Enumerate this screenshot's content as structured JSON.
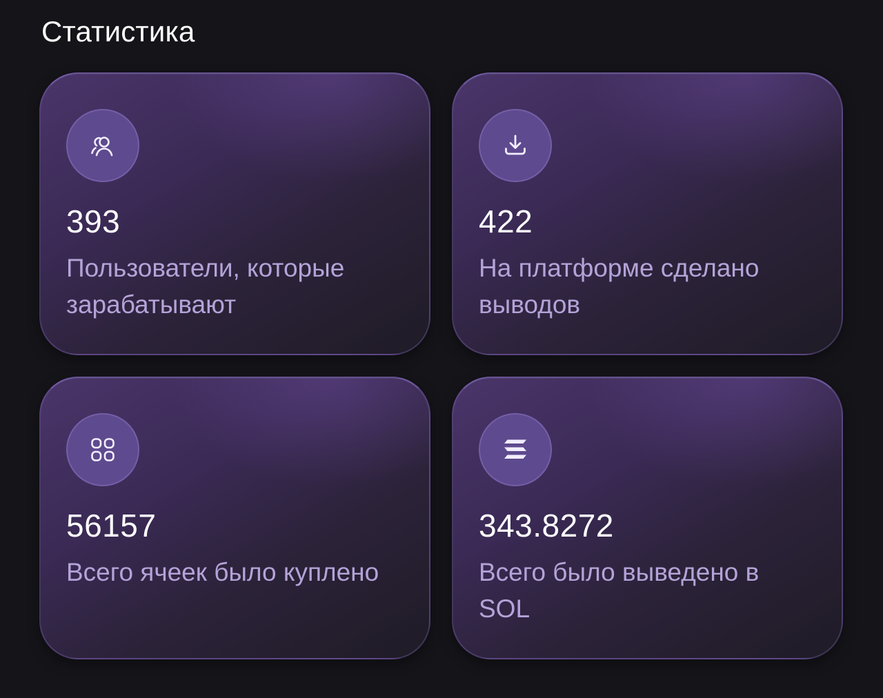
{
  "page": {
    "title": "Статистика"
  },
  "stats": [
    {
      "icon": "users-icon",
      "value": "393",
      "label": "Пользователи, которые зарабатывают"
    },
    {
      "icon": "download-icon",
      "value": "422",
      "label": "На платформе сделано выводов"
    },
    {
      "icon": "grid-icon",
      "value": "56157",
      "label": "Всего ячеек было куплено"
    },
    {
      "icon": "solana-icon",
      "value": "343.8272",
      "label": "Всего было выведено в SOL"
    }
  ],
  "colors": {
    "background": "#141419",
    "card_gradient_start": "#4a3569",
    "card_gradient_end": "#1f1b26",
    "icon_circle": "#5e4a8e",
    "value_text": "#ffffff",
    "label_text": "#b4a3d8"
  }
}
